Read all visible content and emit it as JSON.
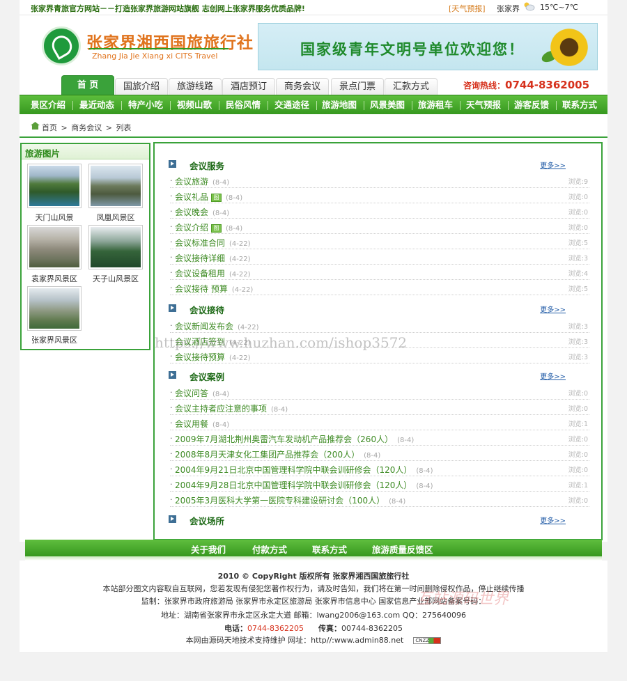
{
  "topbar": {
    "slogan": "张家界青旅官方网站－－打造张家界旅游网站旗舰  志创网上张家界服务优质品牌!",
    "weather_link": "[天气预报]",
    "city": "张家界",
    "temp": "15℃~7℃"
  },
  "header": {
    "brand_cn": "张家界湘西国旅旅行社",
    "brand_en": "Zhang Jia Jie Xiang xi CITS Travel",
    "banner_text": "国家级青年文明号单位欢迎您！"
  },
  "tabs": [
    "首 页",
    "国旅介绍",
    "旅游线路",
    "酒店预订",
    "商务会议",
    "景点门票",
    "汇款方式"
  ],
  "hotline": {
    "label": "咨询热线：",
    "number": "0744-8362005"
  },
  "subnav": [
    "景区介绍",
    "最近动态",
    "特产小吃",
    "视频山歌",
    "民俗风情",
    "交通途径",
    "旅游地图",
    "风景美图",
    "旅游租车",
    "天气预报",
    "游客反馈",
    "联系方式"
  ],
  "breadcrumb": {
    "home": "首页",
    "sep": ">",
    "level1": "商务会议",
    "level2": "列表"
  },
  "sidebar": {
    "title": "旅游图片",
    "pictures": [
      "天门山风景",
      "凤凰风景区",
      "袁家界风景区",
      "天子山风景区",
      "张家界风景区"
    ]
  },
  "list": {
    "more": "更多>>",
    "views_prefix": "浏览:",
    "tu_badge": "图",
    "sections": [
      {
        "title": "会议服务",
        "items": [
          {
            "title": "会议旅游",
            "date": "(8-4)",
            "views": "9",
            "pic": false
          },
          {
            "title": "会议礼品",
            "date": "(8-4)",
            "views": "0",
            "pic": true
          },
          {
            "title": "会议晚会",
            "date": "(8-4)",
            "views": "0",
            "pic": false
          },
          {
            "title": "会议介绍",
            "date": "(8-4)",
            "views": "0",
            "pic": true
          },
          {
            "title": "会议标准合同",
            "date": "(4-22)",
            "views": "5",
            "pic": false
          },
          {
            "title": "会议接待详细",
            "date": "(4-22)",
            "views": "3",
            "pic": false
          },
          {
            "title": "会议设备租用",
            "date": "(4-22)",
            "views": "4",
            "pic": false
          },
          {
            "title": "会议接待 预算",
            "date": "(4-22)",
            "views": "5",
            "pic": false
          }
        ]
      },
      {
        "title": "会议接待",
        "items": [
          {
            "title": "会议新闻发布会",
            "date": "(4-22)",
            "views": "3",
            "pic": false
          },
          {
            "title": "会议酒店签到",
            "date": "(4-22)",
            "views": "3",
            "pic": false
          },
          {
            "title": "会议接待预算",
            "date": "(4-22)",
            "views": "3",
            "pic": false
          }
        ]
      },
      {
        "title": "会议案例",
        "items": [
          {
            "title": "会议问答",
            "date": "(8-4)",
            "views": "0",
            "pic": false
          },
          {
            "title": "会议主持者应注意的事项",
            "date": "(8-4)",
            "views": "0",
            "pic": false
          },
          {
            "title": "会议用餐",
            "date": "(8-4)",
            "views": "1",
            "pic": false
          },
          {
            "title": "2009年7月湖北荆州奥雷汽车发动机产品推荐会（260人）",
            "date": "(8-4)",
            "views": "0",
            "pic": false
          },
          {
            "title": "2008年8月天津女化工集团产品推荐会（200人）",
            "date": "(8-4)",
            "views": "0",
            "pic": false
          },
          {
            "title": "2004年9月21日北京中国管理科学院中联会训研修会（120人）",
            "date": "(8-4)",
            "views": "0",
            "pic": false
          },
          {
            "title": "2004年9月28日北京中国管理科学院中联会训研修会（120人）",
            "date": "(8-4)",
            "views": "1",
            "pic": false
          },
          {
            "title": "2005年3月医科大学第一医院专科建设研讨会（100人）",
            "date": "(8-4)",
            "views": "0",
            "pic": false
          }
        ]
      },
      {
        "title": "会议场所",
        "items": []
      }
    ]
  },
  "watermark": "https://www.huzhan.com/ishop3572",
  "watermark2": "互站源码世界",
  "footer": {
    "nav": [
      "关于我们",
      "付款方式",
      "联系方式",
      "旅游质量反馈区"
    ],
    "copyright": "2010 © CopyRight   版权所有  张家界湘西国旅旅行社",
    "notice": "本站部分图文内容取自互联网，您若发现有侵犯您著作权行为，请及时告知，我们将在第一时间删除侵权作品，停止继续传播",
    "supervise": "监制：张家界市政府旅游局   张家界市永定区旅游局   张家界市信息中心   国家信息产业部网站备案号码：",
    "address_label": "地址：湖南省张家界市永定区永定大道  邮箱：lwang2006@163.com  QQ：275640096",
    "phone_label": "电话：",
    "phone": "0744-8362205",
    "fax_label": "传真：",
    "fax": "00744-8362205",
    "support": "本网由源码天地技术支持维护       网址：http//:www.admin88.net",
    "cnzz": "CNZZ"
  },
  "colors": {
    "accent": "#3aa23a",
    "brand": "#e0731c",
    "link": "#3c8a22",
    "hot": "#d6311c"
  }
}
